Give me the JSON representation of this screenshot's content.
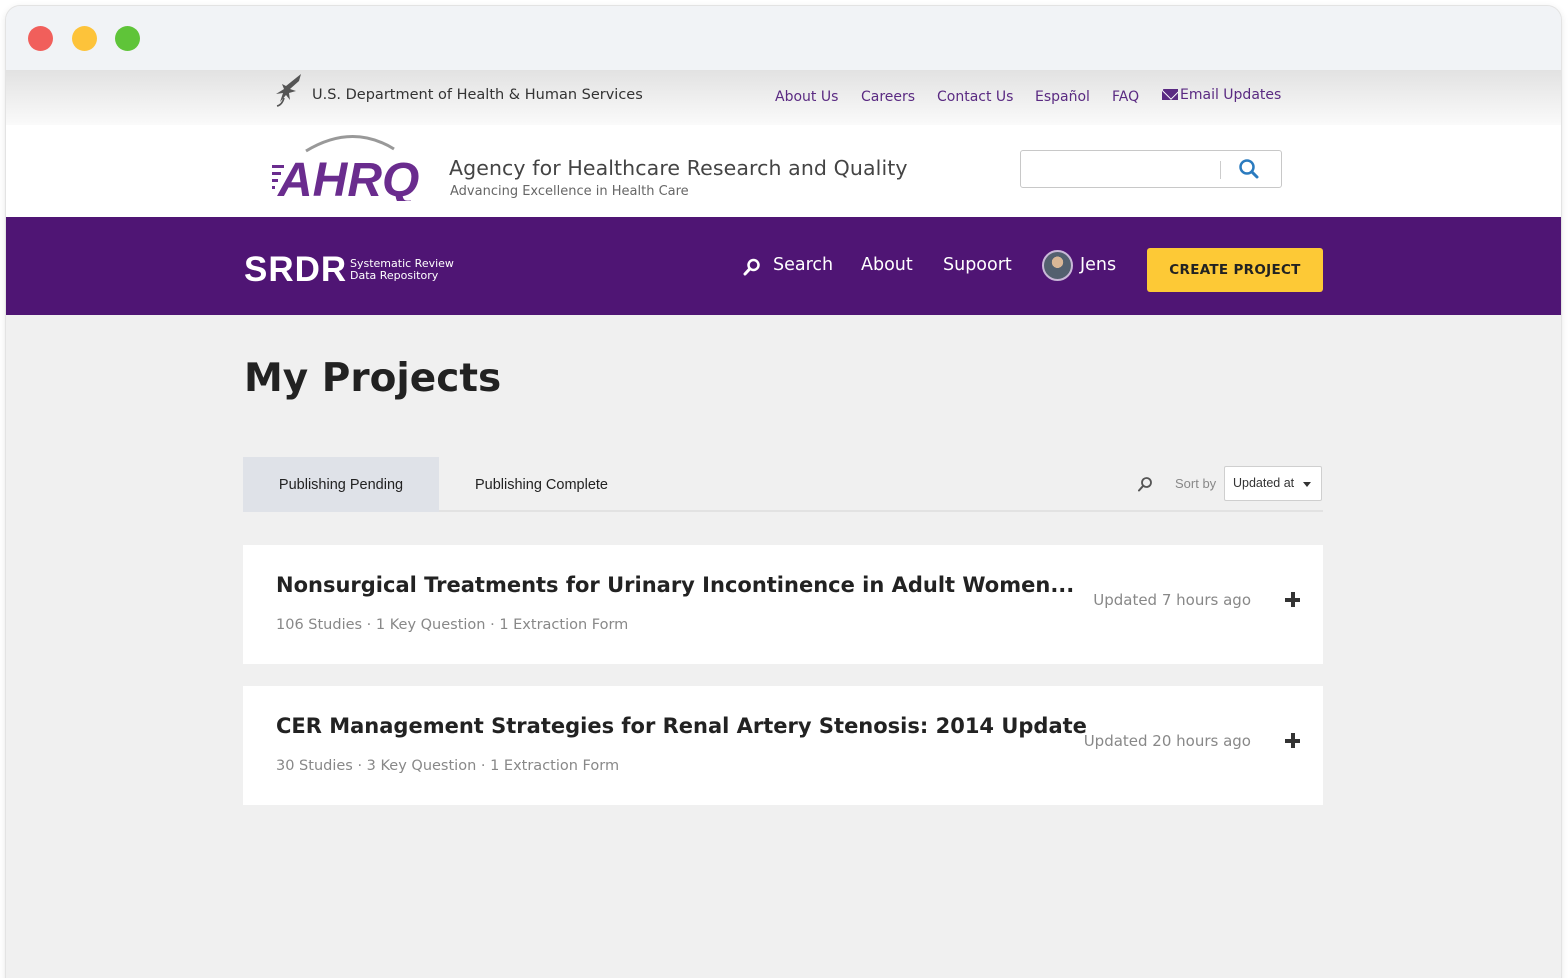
{
  "hhs": {
    "title": "U.S. Department of Health & Human Services",
    "links": [
      "About Us",
      "Careers",
      "Contact Us",
      "Español",
      "FAQ"
    ],
    "email_updates": "Email Updates"
  },
  "ahrq": {
    "logo_text": "AHRQ",
    "name": "Agency for Healthcare Research and Quality",
    "tagline": "Advancing Excellence in Health Care",
    "search_value": ""
  },
  "nav": {
    "logo_text": "SRDR",
    "logo_sub1": "Systematic Review",
    "logo_sub2": "Data Repository",
    "search": "Search",
    "about": "About",
    "support": "Supoort",
    "user": "Jens",
    "create_project": "CREATE PROJECT"
  },
  "page": {
    "title": "My Projects"
  },
  "tabs": [
    {
      "label": "Publishing Pending",
      "active": true
    },
    {
      "label": "Publishing Complete",
      "active": false
    }
  ],
  "sort": {
    "label": "Sort by",
    "selected": "Updated at"
  },
  "projects": [
    {
      "title": "Nonsurgical Treatments for Urinary Incontinence in Adult Women...",
      "meta": "106 Studies · 1 Key Question · 1 Extraction Form",
      "updated": "Updated 7 hours ago"
    },
    {
      "title": "CER Management Strategies for Renal Artery Stenosis: 2014 Update",
      "meta": "30 Studies · 3 Key Question · 1 Extraction Form",
      "updated": "Updated 20 hours ago"
    }
  ],
  "colors": {
    "brand_purple": "#4f1574",
    "link_purple": "#5a2a82",
    "button_yellow": "#fdc936",
    "search_blue": "#2b7bbf"
  },
  "icons": [
    "hhs-eagle-icon",
    "mail-icon",
    "search-icon",
    "avatar",
    "caret-down-icon",
    "plus-icon"
  ]
}
